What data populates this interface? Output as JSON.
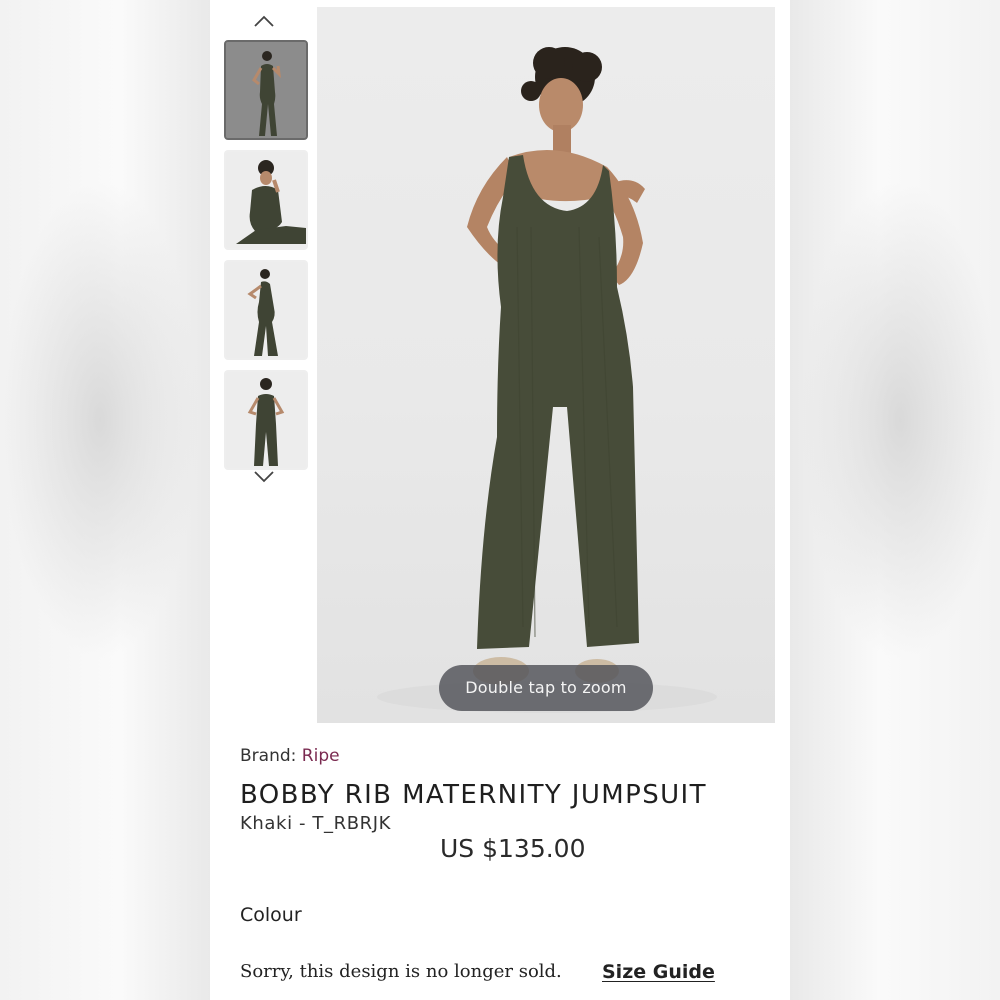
{
  "gallery": {
    "up_icon": "chevron-up-icon",
    "down_icon": "chevron-down-icon",
    "thumbnails": [
      {
        "pose": "standing-front",
        "active": true
      },
      {
        "pose": "seated"
      },
      {
        "pose": "standing-side"
      },
      {
        "pose": "standing-back"
      }
    ],
    "zoom_hint": "Double tap to zoom"
  },
  "product": {
    "brand_label": "Brand:",
    "brand_name": "Ripe",
    "title": "BOBBY RIB MATERNITY JUMPSUIT",
    "variant": "Khaki - T_RBRJK",
    "price": "US $135.00"
  },
  "options": {
    "colour_label": "Colour",
    "availability_note": "Sorry, this design is no longer sold.",
    "size_guide_label": "Size Guide"
  },
  "colors": {
    "jumpsuit": "#4a4f3c",
    "brand_accent": "#7a2a50",
    "zoom_pill": "#505258"
  }
}
